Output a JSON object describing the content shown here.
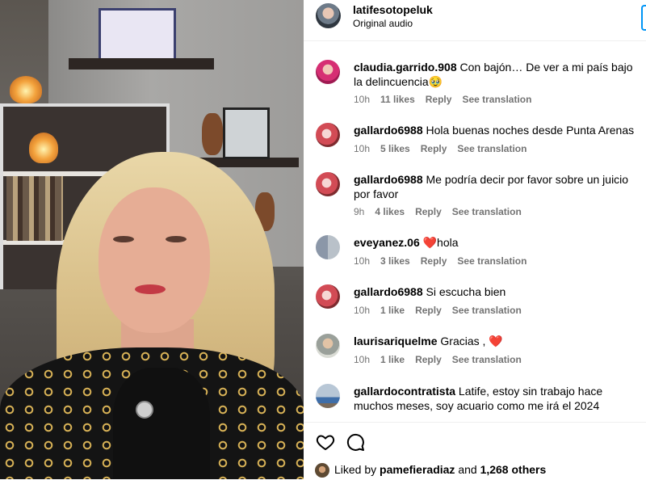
{
  "post": {
    "username": "latifesotopeluk",
    "audio": "Original audio"
  },
  "comments": [
    {
      "user": "claudia.garrido.908",
      "text": "Con bajón… De ver a mi país bajo la delincuencia🥹",
      "time": "10h",
      "likes": "11 likes",
      "reply": "Reply",
      "translate": "See translation"
    },
    {
      "user": "gallardo6988",
      "text": "Hola buenas noches desde Punta Arenas",
      "time": "10h",
      "likes": "5 likes",
      "reply": "Reply",
      "translate": "See translation"
    },
    {
      "user": "gallardo6988",
      "text": "Me podría decir por favor sobre un juicio por favor",
      "time": "9h",
      "likes": "4 likes",
      "reply": "Reply",
      "translate": "See translation"
    },
    {
      "user": "eveyanez.06",
      "text": "❤️hola",
      "time": "10h",
      "likes": "3 likes",
      "reply": "Reply",
      "translate": "See translation"
    },
    {
      "user": "gallardo6988",
      "text": "Si escucha bien",
      "time": "10h",
      "likes": "1 like",
      "reply": "Reply",
      "translate": "See translation"
    },
    {
      "user": "laurisariquelme",
      "text": "Gracias , ❤️",
      "time": "10h",
      "likes": "1 like",
      "reply": "Reply",
      "translate": "See translation"
    },
    {
      "user": "gallardocontratista",
      "text": "Latife, estoy sin trabajo hace muchos meses, soy acuario como me irá el 2024"
    }
  ],
  "footer": {
    "liked_by_prefix": "Liked by",
    "liked_by_user": "pamefieradiaz",
    "and": "and",
    "others": "1,268 others"
  },
  "icons": {
    "like": "heart-outline-icon",
    "comment": "comment-bubble-icon"
  },
  "colors": {
    "text_secondary": "#737373",
    "border": "#efefef",
    "accent": "#0095f6"
  }
}
